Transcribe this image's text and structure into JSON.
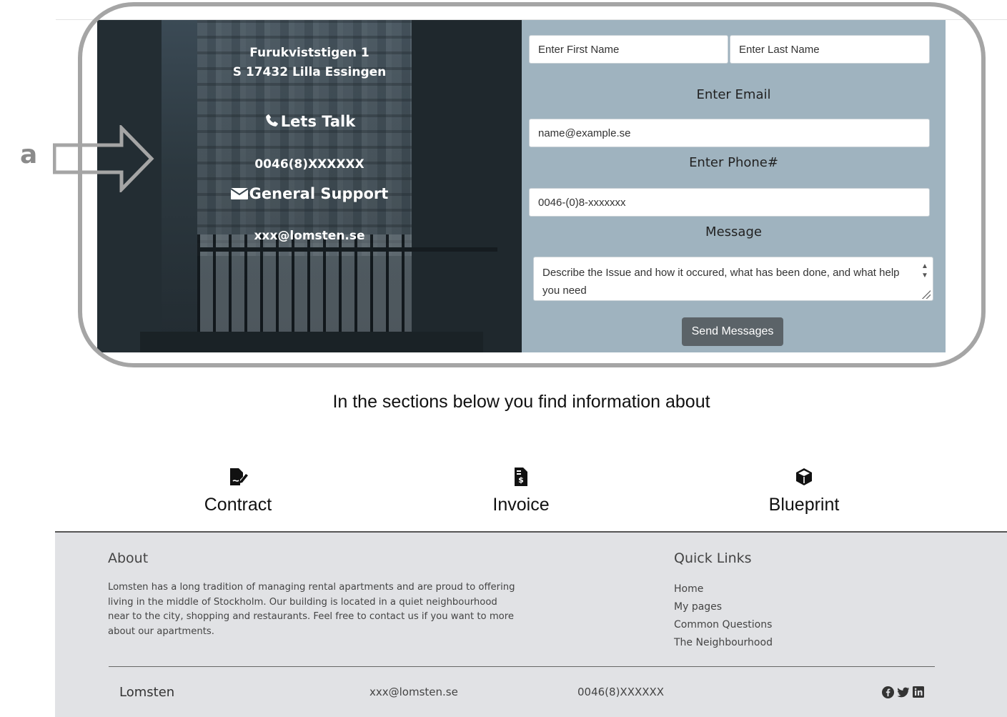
{
  "annotation": {
    "label": "a"
  },
  "contact": {
    "address_line1": "Furukviststigen 1",
    "address_line2": "S 17432 Lilla Essingen",
    "talk_heading": "Lets Talk",
    "phone": "0046(8)XXXXXX",
    "support_heading": "General Support",
    "email": "xxx@lomsten.se",
    "icons": [
      "phone-icon",
      "envelope-icon"
    ]
  },
  "form": {
    "first_name_placeholder": "Enter First Name",
    "last_name_placeholder": "Enter Last Name",
    "email_label": "Enter Email",
    "email_placeholder": "name@example.se",
    "phone_label": "Enter Phone#",
    "phone_placeholder": "0046-(0)8-xxxxxxx",
    "message_label": "Message",
    "message_placeholder": "Describe the Issue and how it occured, what has been done, and what help you need",
    "send_label": "Send Messages"
  },
  "intro": {
    "text": "In the sections below you find information about"
  },
  "features": [
    {
      "label": "Contract",
      "icon": "file-signature-icon"
    },
    {
      "label": "Invoice",
      "icon": "file-invoice-dollar-icon"
    },
    {
      "label": "Blueprint",
      "icon": "cube-icon"
    }
  ],
  "footer": {
    "about_heading": "About",
    "about_text": "Lomsten has a long tradition of managing rental apartments and are proud to offering living in the middle of Stockholm. Our building is located in a quiet neighbourhood near to the city, shopping and restaurants. Feel free to contact us if you want to more about our apartments.",
    "quick_links_heading": "Quick Links",
    "quick_links": [
      "Home",
      "My pages",
      "Common Questions",
      "The Neighbourhood"
    ],
    "brand": "Lomsten",
    "email": "xxx@lomsten.se",
    "phone": "0046(8)XXXXXX",
    "social_icons": [
      "facebook-icon",
      "twitter-icon",
      "linkedin-icon"
    ]
  },
  "colors": {
    "form_bg": "#9fb3bf",
    "button_bg": "#5b6368",
    "footer_bg": "#e1e2e5",
    "annotation": "#a5a5a5"
  }
}
